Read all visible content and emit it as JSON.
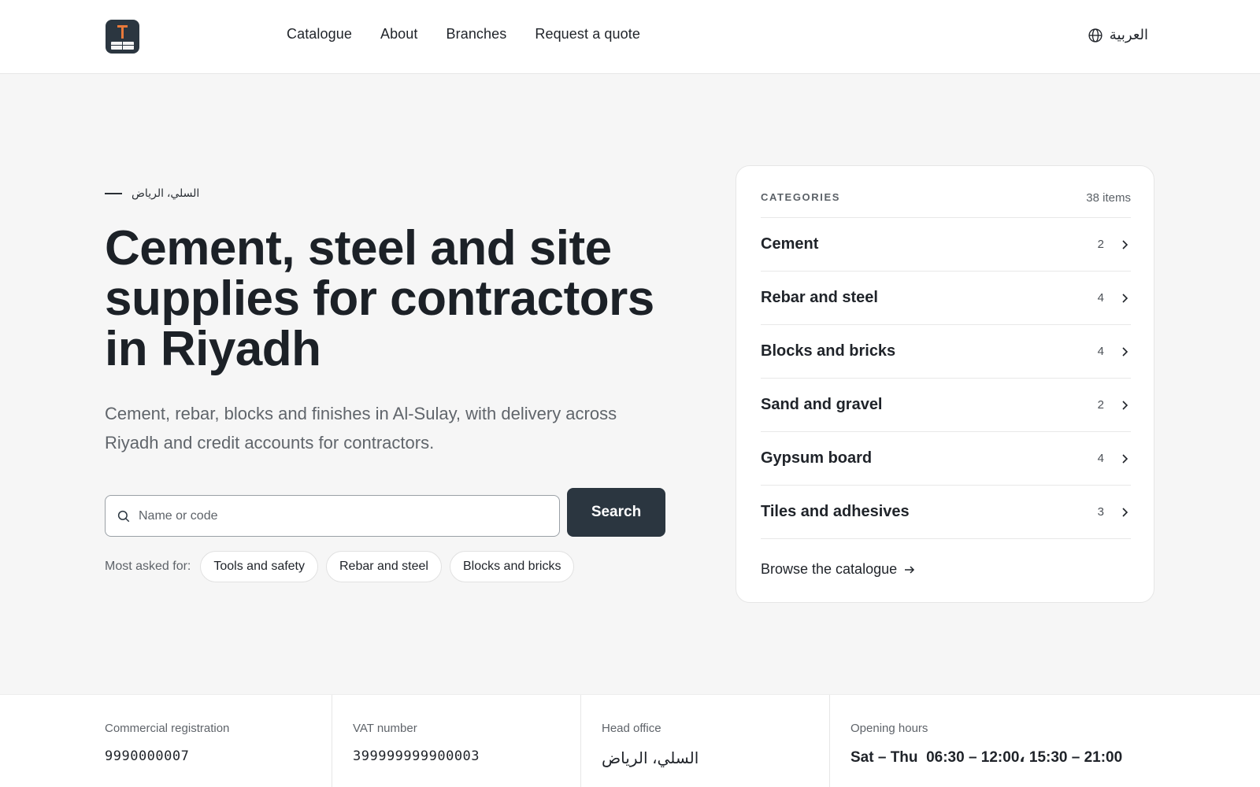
{
  "header": {
    "nav": [
      "Catalogue",
      "About",
      "Branches",
      "Request a quote"
    ],
    "language_label": "العربية",
    "language_icon": "globe-icon"
  },
  "hero": {
    "location": "السلي، الرياض",
    "title": "Cement, steel and site supplies for contractors in Riyadh",
    "subtitle": "Cement, rebar, blocks and finishes in Al-Sulay, with delivery across Riyadh and credit accounts for contractors.",
    "search": {
      "placeholder": "Name or code",
      "value": "",
      "button_label": "Search"
    },
    "most_asked_label": "Most asked for:",
    "chips": [
      "Tools and safety",
      "Rebar and steel",
      "Blocks and bricks"
    ]
  },
  "categories": {
    "caption": "CATEGORIES",
    "count_label": "38 items",
    "items": [
      {
        "name": "Cement",
        "count": "2"
      },
      {
        "name": "Rebar and steel",
        "count": "4"
      },
      {
        "name": "Blocks and bricks",
        "count": "4"
      },
      {
        "name": "Sand and gravel",
        "count": "2"
      },
      {
        "name": "Gypsum board",
        "count": "4"
      },
      {
        "name": "Tiles and adhesives",
        "count": "3"
      }
    ],
    "browse_label": "Browse the catalogue"
  },
  "info": {
    "commercial_registration": {
      "label": "Commercial registration",
      "value": "9990000007"
    },
    "vat_number": {
      "label": "VAT number",
      "value": "399999999900003"
    },
    "head_office": {
      "label": "Head office",
      "value": "السلي، الرياض"
    },
    "opening_hours": {
      "label": "Opening hours",
      "value": "Sat – Thu  06:30 – 12:00، 15:30 – 21:00"
    }
  },
  "colors": {
    "primary": "#2b3640",
    "accent": "#e8793a",
    "background": "#f6f6f6"
  }
}
